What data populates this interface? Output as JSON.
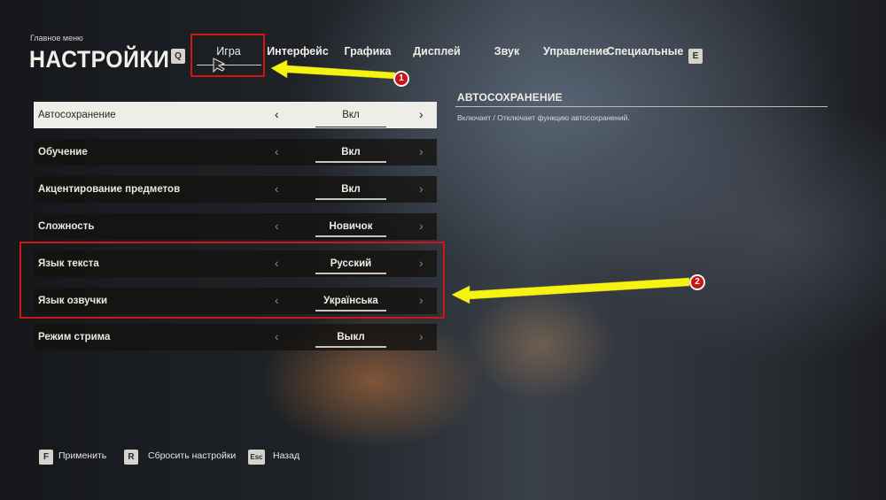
{
  "header": {
    "breadcrumb": "Главное меню",
    "title": "НАСТРОЙКИ",
    "prev_key": "Q",
    "next_key": "E"
  },
  "tabs": [
    {
      "label": "Игра",
      "active": true
    },
    {
      "label": "Интерфейс"
    },
    {
      "label": "Графика"
    },
    {
      "label": "Дисплей"
    },
    {
      "label": "Звук"
    },
    {
      "label": "Управление"
    },
    {
      "label": "Специальные"
    }
  ],
  "settings": [
    {
      "label": "Автосохранение",
      "value": "Вкл",
      "selected": true
    },
    {
      "label": "Обучение",
      "value": "Вкл"
    },
    {
      "label": "Акцентирование предметов",
      "value": "Вкл"
    },
    {
      "label": "Сложность",
      "value": "Новичок"
    },
    {
      "label": "Язык текста",
      "value": "Русский"
    },
    {
      "label": "Язык озвучки",
      "value": "Українська"
    },
    {
      "label": "Режим стрима",
      "value": "Выкл"
    }
  ],
  "description": {
    "title": "АВТОСОХРАНЕНИЕ",
    "text": "Включает / Отключает функцию автосохранений."
  },
  "footer": {
    "apply_key": "F",
    "apply_label": "Применить",
    "reset_key": "R",
    "reset_label": "Сбросить настройки",
    "back_key": "Esc",
    "back_label": "Назад"
  },
  "annotations": {
    "marker_1": "1",
    "marker_2": "2",
    "highlight_color": "#d11414",
    "arrow_color": "#f5f214"
  }
}
